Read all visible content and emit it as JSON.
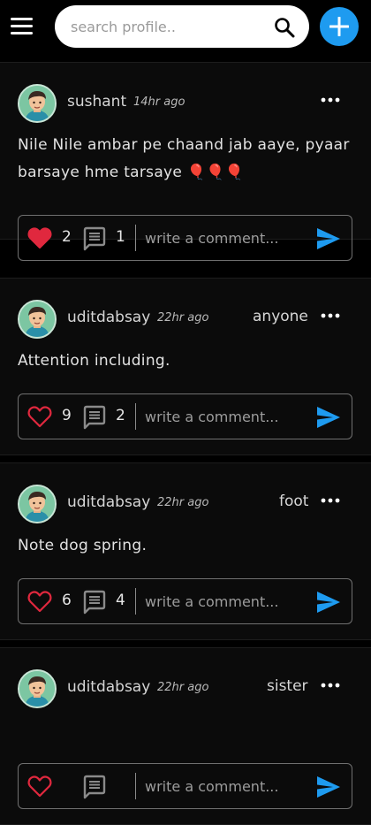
{
  "search": {
    "placeholder": "search profile.."
  },
  "colors": {
    "accent": "#1e9bf0",
    "like_red": "#e0283e",
    "background": "#000000",
    "card": "#0b0b0b"
  },
  "icons": {
    "menu": "hamburger-menu-icon",
    "search": "search-icon",
    "add": "plus-icon",
    "more": "more-horizontal-icon",
    "like": "heart-icon",
    "comment": "comment-icon",
    "send": "send-icon"
  },
  "posts": [
    {
      "username": "sushant",
      "time": "14hr ago",
      "tag": "",
      "text": "Nile Nile ambar pe chaand jab aaye, pyaar barsaye hme tarsaye 🎈🎈🎈",
      "likes": "2",
      "liked": true,
      "comments": "1",
      "comment_placeholder": "write a comment..."
    },
    {
      "username": "uditdabsay",
      "time": "22hr ago",
      "tag": "anyone",
      "text": "Attention including.",
      "likes": "9",
      "liked": false,
      "comments": "2",
      "comment_placeholder": "write a comment..."
    },
    {
      "username": "uditdabsay",
      "time": "22hr ago",
      "tag": "foot",
      "text": "Note dog spring.",
      "likes": "6",
      "liked": false,
      "comments": "4",
      "comment_placeholder": "write a comment..."
    },
    {
      "username": "uditdabsay",
      "time": "22hr ago",
      "tag": "sister",
      "text": "",
      "likes": "",
      "liked": false,
      "comments": "",
      "comment_placeholder": "write a comment..."
    }
  ]
}
